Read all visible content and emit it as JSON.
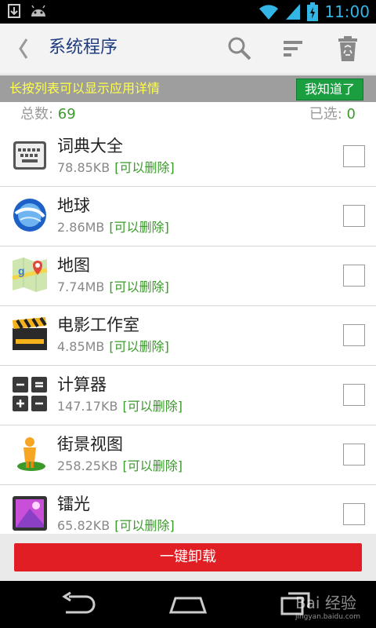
{
  "status_bar": {
    "time": "11:00"
  },
  "action_bar": {
    "title": "系统程序"
  },
  "tip": {
    "text": "长按列表可以显示应用详情",
    "button": "我知道了"
  },
  "summary": {
    "total_label": "总数: ",
    "total": "69",
    "selected_label": "已选: ",
    "selected": "0"
  },
  "apps": [
    {
      "name": "词典大全",
      "size": "78.85KB",
      "tag": "[可以删除]"
    },
    {
      "name": "地球",
      "size": "2.86MB",
      "tag": "[可以删除]"
    },
    {
      "name": "地图",
      "size": "7.74MB",
      "tag": "[可以删除]"
    },
    {
      "name": "电影工作室",
      "size": "4.85MB",
      "tag": "[可以删除]"
    },
    {
      "name": "计算器",
      "size": "147.17KB",
      "tag": "[可以删除]"
    },
    {
      "name": "街景视图",
      "size": "258.25KB",
      "tag": "[可以删除]"
    },
    {
      "name": "镭光",
      "size": "65.82KB",
      "tag": "[可以删除]"
    }
  ],
  "uninstall_button": "一键卸载",
  "watermark": {
    "brand": "Bai 经验",
    "url": "jingyan.baidu.com"
  },
  "colors": {
    "accent_green": "#3a9a2a",
    "title_blue": "#1d3b80",
    "uninstall_red": "#e01e24",
    "tip_yellow": "#ffff4c"
  }
}
